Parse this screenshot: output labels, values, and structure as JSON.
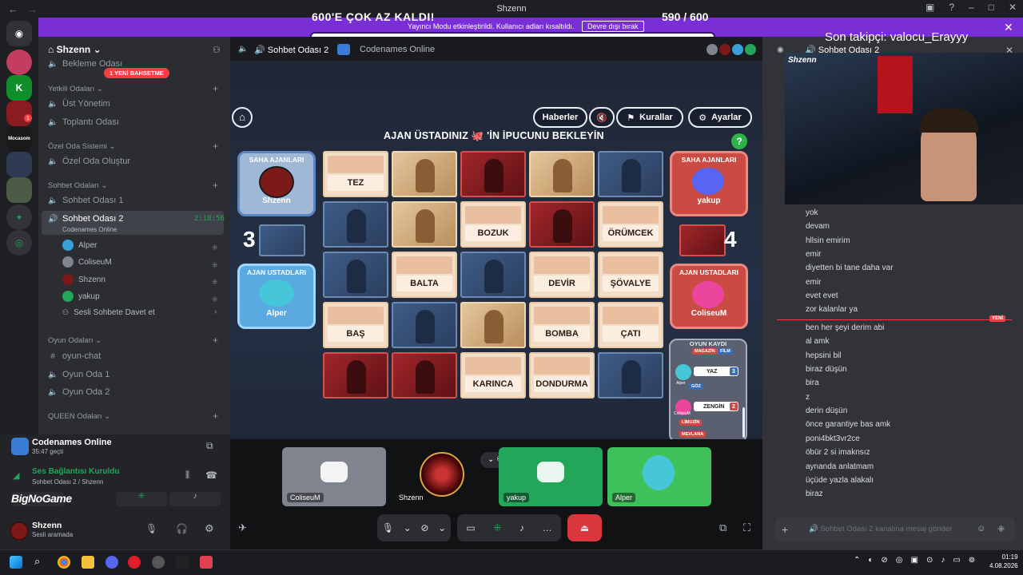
{
  "window": {
    "title": "Shzenn"
  },
  "banner": {
    "goal": "600'E ÇOK AZ KALDI!",
    "count": "590 / 600",
    "mode_text": "Yayıncı Modu etkinleştirildi. Kullanıcı adları kısaltıldı.",
    "disable_button": "Devre dışı bırak",
    "progress": 0.983
  },
  "sidebar": {
    "server_name": "Shzenn",
    "new_badge": "1 YENİ BAHSETME",
    "items": {
      "waiting": "Bekleme Odası",
      "cat_staff": "Yetkili Odaları",
      "ust_yonetim": "Üst Yönetim",
      "toplanti": "Toplantı Odası",
      "cat_private": "Özel Oda Sistemi",
      "ozel_olustur": "Özel Oda Oluştur",
      "cat_chat": "Sohbet Odaları",
      "sohbet1": "Sohbet Odası 1",
      "sohbet2": "Sohbet Odası 2",
      "sohbet2_timer": "2:18:56",
      "sohbet2_activity": "Codenames Online",
      "invite": "Sesli Sohbete Davet et",
      "cat_game": "Oyun Odaları",
      "oyun_chat": "oyun-chat",
      "oyun1": "Oyun Oda 1",
      "oyun2": "Oyun Oda 2",
      "cat_queen": "QUEEN Odaları"
    },
    "members": [
      "Alper",
      "ColiseuM",
      "Shzenn",
      "yakup"
    ]
  },
  "activity": {
    "title": "Codenames Online",
    "time": "35:47 geçti",
    "voice_status": "Ses Bağlantısı Kuruldu",
    "voice_sub": "Sohbet Odası 2 / Shzenn",
    "watermark": "BigNoGame",
    "user_name": "Shzenn",
    "user_status": "Sesli aramada"
  },
  "main_header": {
    "channel": "Sohbet Odası 2",
    "activity": "Codenames Online"
  },
  "game": {
    "buttons": {
      "news": "Haberler",
      "rules": "Kurallar",
      "settings": "Ayarlar"
    },
    "waiting": "AJAN ÜSTADINIZ 🐙 'İN İPUCUNU BEKLEYİN",
    "blue_team": {
      "field_title": "SAHA AJANLARI",
      "field_player": "Shzenn",
      "master_title": "AJAN USTADLARI",
      "master_player": "Alper",
      "remaining": "3"
    },
    "red_team": {
      "field_title": "SAHA AJANLARI",
      "field_player": "yakup",
      "master_title": "AJAN USTADLARI",
      "master_player": "ColiseuM",
      "remaining": "4"
    },
    "cards": [
      [
        "TEZ",
        "",
        "",
        "",
        ""
      ],
      [
        "",
        "",
        "BOZUK",
        "",
        "ÖRÜMCEK"
      ],
      [
        "",
        "BALTA",
        "",
        "DEVİR",
        "ŞÖVALYE"
      ],
      [
        "BAŞ",
        "",
        "",
        "BOMBA",
        "ÇATI"
      ],
      [
        "",
        "",
        "KARINCA",
        "DONDURMA",
        ""
      ]
    ],
    "card_types": [
      [
        "word",
        "beige",
        "red",
        "beige",
        "blue"
      ],
      [
        "blue",
        "beige",
        "word",
        "red",
        "word"
      ],
      [
        "blue",
        "word",
        "blue",
        "word",
        "word"
      ],
      [
        "word",
        "blue",
        "beige",
        "word",
        "word"
      ],
      [
        "red",
        "red",
        "word",
        "word",
        "blue"
      ]
    ],
    "log": {
      "title": "OYUN KAYDI",
      "chips_top": [
        "MAGAZİN",
        "FİLM"
      ],
      "clue1": {
        "word": "YAZ",
        "num": "3",
        "player": "Alper"
      },
      "chip_goz": "GÖZ",
      "clue2": {
        "word": "ZENGİN",
        "num": "2",
        "player": "ColiseuM"
      },
      "chips_bottom": [
        "LİMUZİN",
        "MEVLANA"
      ]
    }
  },
  "tiles": [
    {
      "name": "ColiseuM"
    },
    {
      "name": "Shzenn"
    },
    {
      "name": "yakup"
    },
    {
      "name": "Alper"
    }
  ],
  "right": {
    "follower": "Son takipçi: valocu_Erayyy",
    "header": "Sohbet Odası 2",
    "webcam_name": "Shzenn",
    "messages_before": [
      "yok",
      "devam",
      "hllsin emirim",
      "emir",
      "diyetten bi tane daha var",
      "emir",
      "evet evet",
      "zor kalanlar ya"
    ],
    "new_tag": "YENİ",
    "messages_after": [
      "ben her şeyi derim abi",
      "al amk",
      "hepsini bil",
      "biraz düşün",
      "bira",
      "z",
      "derin düşün",
      "önce garantiye bas amk",
      "poni4bkt3vr2ce",
      "öbür 2 si imaknsız",
      "aynanda anlatmam",
      "üçüde yazla alakalı",
      "biraz"
    ],
    "chat_placeholder": "Sohbet Odası 2 kanalına mesaj gönder"
  },
  "clock": {
    "time": "01:19",
    "date": "4.08.2026"
  },
  "colors": {
    "banner": "#7a2fd6",
    "blurple": "#5865f2",
    "online": "#23a55a",
    "danger": "#f23f43"
  }
}
